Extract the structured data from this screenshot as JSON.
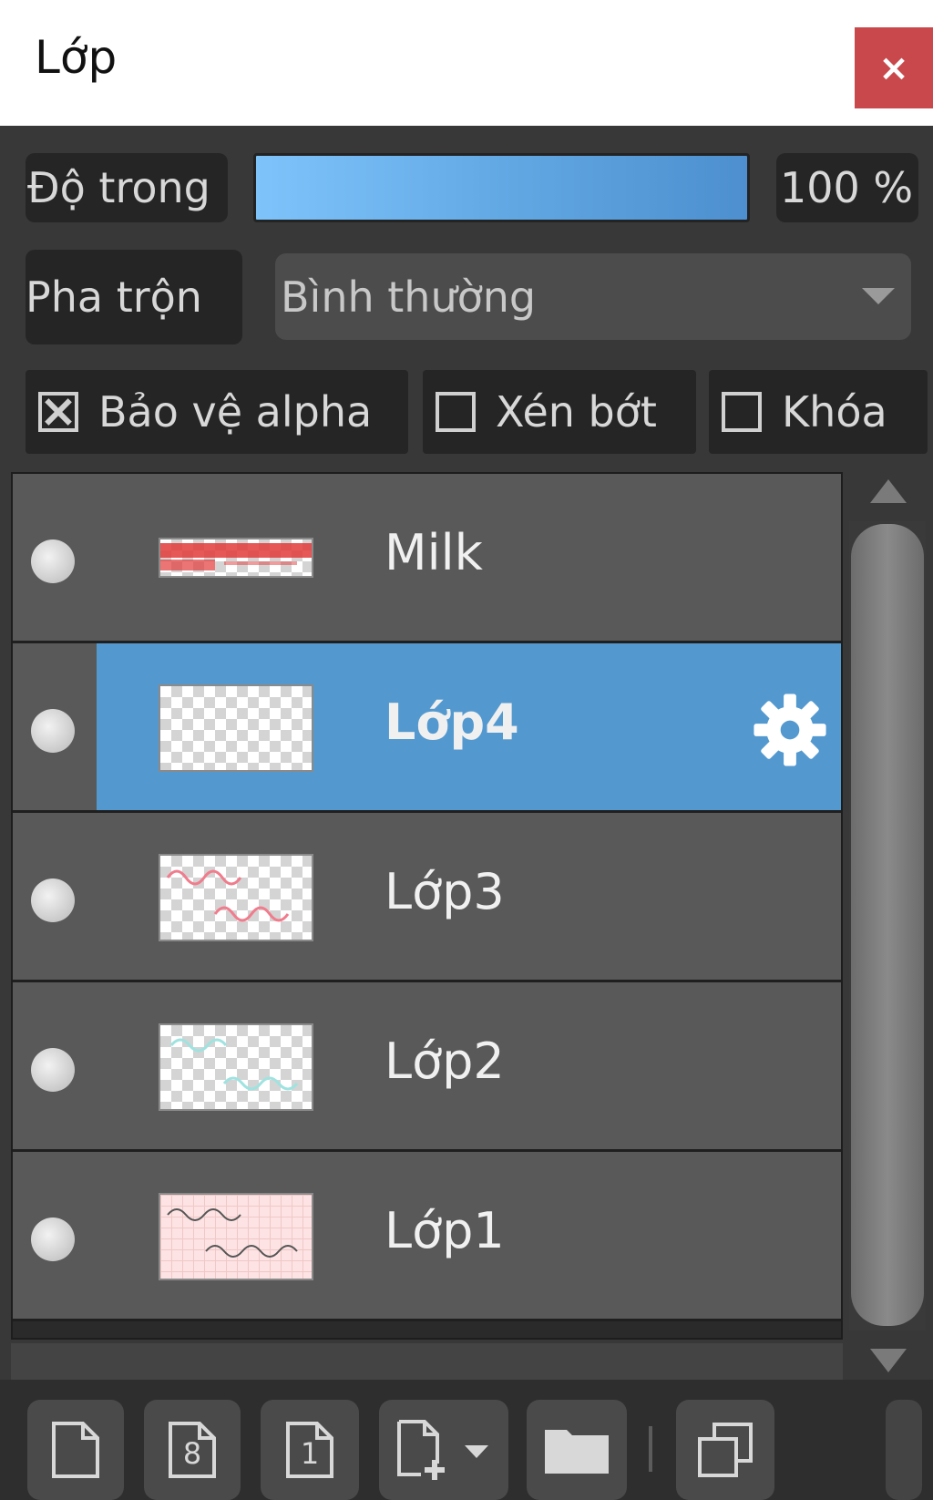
{
  "window": {
    "title": "Lớp",
    "close_label": "×"
  },
  "opacity": {
    "label": "Độ trong",
    "value": "100 %"
  },
  "blend": {
    "label": "Pha trộn",
    "value": "Bình thường"
  },
  "options": {
    "protect_alpha": {
      "label": "Bảo vệ alpha",
      "checked": true
    },
    "clipping": {
      "label": "Xén bớt",
      "checked": false
    },
    "lock": {
      "label": "Khóa",
      "checked": false
    }
  },
  "layers": [
    {
      "name": "Milk",
      "selected": false
    },
    {
      "name": "Lớp4",
      "selected": true
    },
    {
      "name": "Lớp3",
      "selected": false
    },
    {
      "name": "Lớp2",
      "selected": false
    },
    {
      "name": "Lớp1",
      "selected": false
    }
  ],
  "toolbar": {
    "buttons": [
      "new-layer-icon",
      "new-8bit-layer-icon",
      "new-1bit-layer-icon",
      "add-layer-menu-icon",
      "folder-icon",
      "duplicate-layer-icon"
    ],
    "icon_labels": {
      "eight": "8",
      "one": "1"
    }
  },
  "colors": {
    "selected": "#5399cf",
    "close": "#c9484c",
    "opacity_fill": "#62a9e4"
  }
}
